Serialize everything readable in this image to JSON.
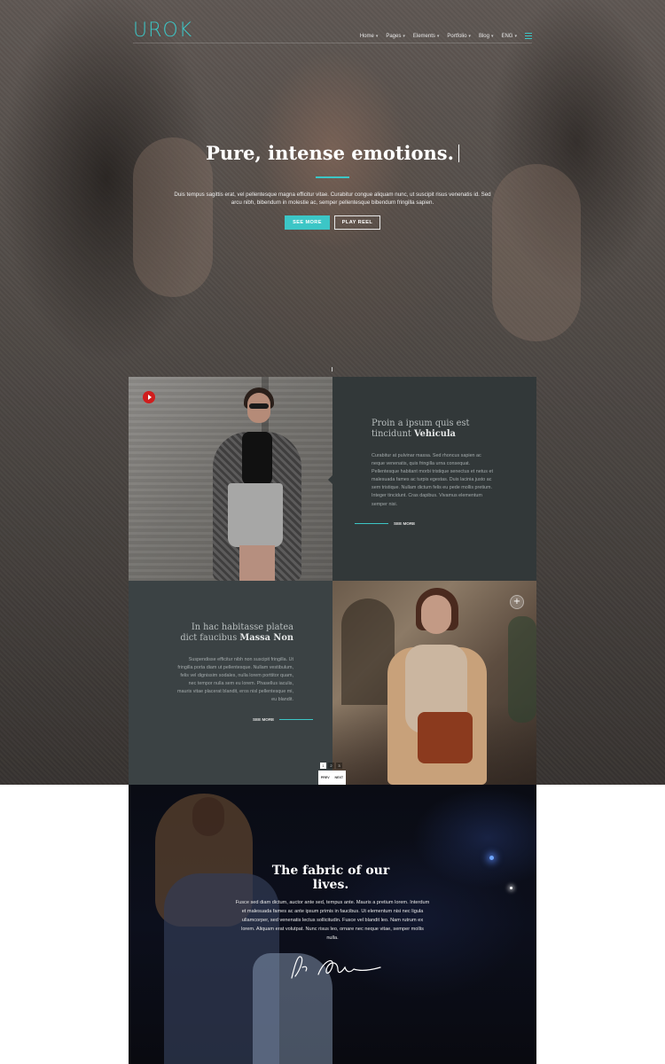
{
  "brand": {
    "logo": "UROK"
  },
  "nav": {
    "items": [
      {
        "label": "Home"
      },
      {
        "label": "Pages"
      },
      {
        "label": "Elements"
      },
      {
        "label": "Portfolio"
      },
      {
        "label": "Blog"
      },
      {
        "label": "ENG"
      }
    ],
    "chevron": "▾"
  },
  "hero": {
    "title": "Pure, intense emotions.",
    "text": "Duis tempus sagittis erat, vel pellentesque magna efficitur vitae. Curabitur congue aliquam nunc, ut suscipit risus venenatis id. Sed arcu nibh, bibendum in molestie ac, semper pellentesque bibendum fringilla sapien.",
    "primary_button": "SEE MORE",
    "secondary_button": "PLAY REEL"
  },
  "feature1": {
    "title_plain": "Proin a ipsum quis est tincidunt",
    "title_bold": "Vehicula",
    "text": "Curabitur at pulvinar massa. Sed rhoncus sapien ac neque venenatis, quis fringilla urna consequat. Pellentesque habitant morbi tristique senectus et netus et malesuada fames ac turpis egestas. Duis lacinia justo ac sem tristique. Nullam dictum felis eu pede mollis pretium. Integer tincidunt. Cras dapibus. Vivamus elementum semper nisi.",
    "link": "SEE MORE"
  },
  "feature2": {
    "title_plain": "In hac habitasse platea dict faucibus",
    "title_bold": "Massa Non",
    "text": "Suspendisse efficitur nibh non suscipit fringilla. Ut fringilla porta diam ut pellentesque. Nullam vestibulum, felis vel dignissim sodales, nulla lorem porttitor quam, nec tempor nulla sem eu lorem. Phasellus iaculis, mauris vitae placerat blandit, eros nisl pellentesque mi, eu blandit.",
    "link": "SEE MORE"
  },
  "slider": {
    "pages": [
      "1",
      "2",
      "3"
    ],
    "active_page": 1,
    "prev": "PREV",
    "next": "NEXT",
    "plus": "+"
  },
  "quote": {
    "title": "The fabric of our lives.",
    "text": "Fusce sed diam dictum, auctor ante sed, tempus ante. Mauris a pretium lorem. Interdum et malesuada fames ac ante ipsum primis in faucibus. Ut elementum nisi nec ligula ullamcorper, sed venenatis lectus sollicitudin. Fusce vel blandit leo. Nam rutrum ex lorem. Aliquam erat volutpat. Nunc risus leo, ornare nec neque vitae, semper mollis nulla."
  },
  "colors": {
    "accent": "#3cc6c6",
    "panel_dark": "#323839",
    "play_red": "#d01d1d"
  }
}
